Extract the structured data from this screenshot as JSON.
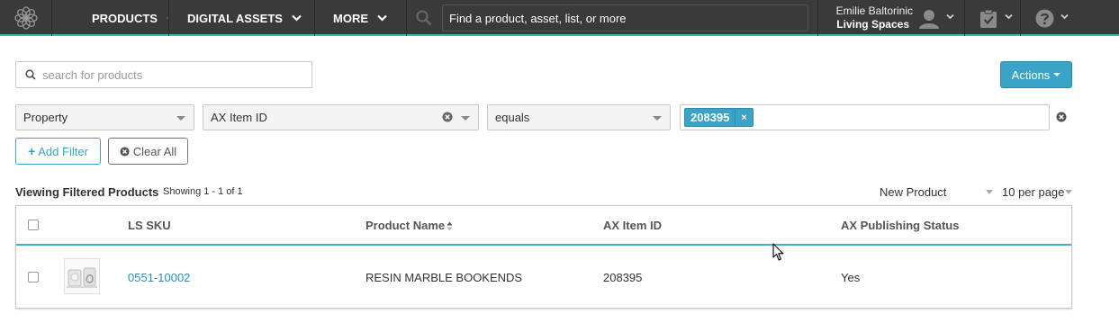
{
  "nav": {
    "menus": [
      {
        "label": "PRODUCTS"
      },
      {
        "label": "DIGITAL ASSETS"
      },
      {
        "label": "MORE"
      }
    ],
    "search_placeholder": "Find a product, asset, list, or more",
    "user_name": "Emilie Baltorinic",
    "user_org": "Living Spaces"
  },
  "search": {
    "placeholder": "search for products"
  },
  "actions_label": "Actions",
  "filter": {
    "property": "Property",
    "field": "AX Item ID",
    "operator": "equals",
    "tag": "208395",
    "tag_remove": "×"
  },
  "buttons": {
    "add_filter": "Add Filter",
    "clear_all": "Clear All"
  },
  "results": {
    "viewing_label": "Viewing Filtered Products",
    "showing_label": "Showing 1 - 1 of 1",
    "sort_label": "New Product",
    "per_page_label": "10 per page"
  },
  "table": {
    "columns": [
      "LS SKU",
      "Product Name",
      "AX Item ID",
      "AX Publishing Status"
    ],
    "rows": [
      {
        "sku": "0551-10002",
        "name": "RESIN MARBLE BOOKENDS",
        "ax_item_id": "208395",
        "status": "Yes"
      }
    ]
  },
  "colors": {
    "accent": "#3aa3c6",
    "nav_bg": "#3a3a3a",
    "link": "#2a8fb5"
  },
  "icons": [
    "logo-icon",
    "chevron-down-icon",
    "search-icon",
    "user-icon",
    "clipboard-check-icon",
    "help-icon",
    "clear-circle-icon",
    "sort-icon",
    "cursor-icon"
  ]
}
